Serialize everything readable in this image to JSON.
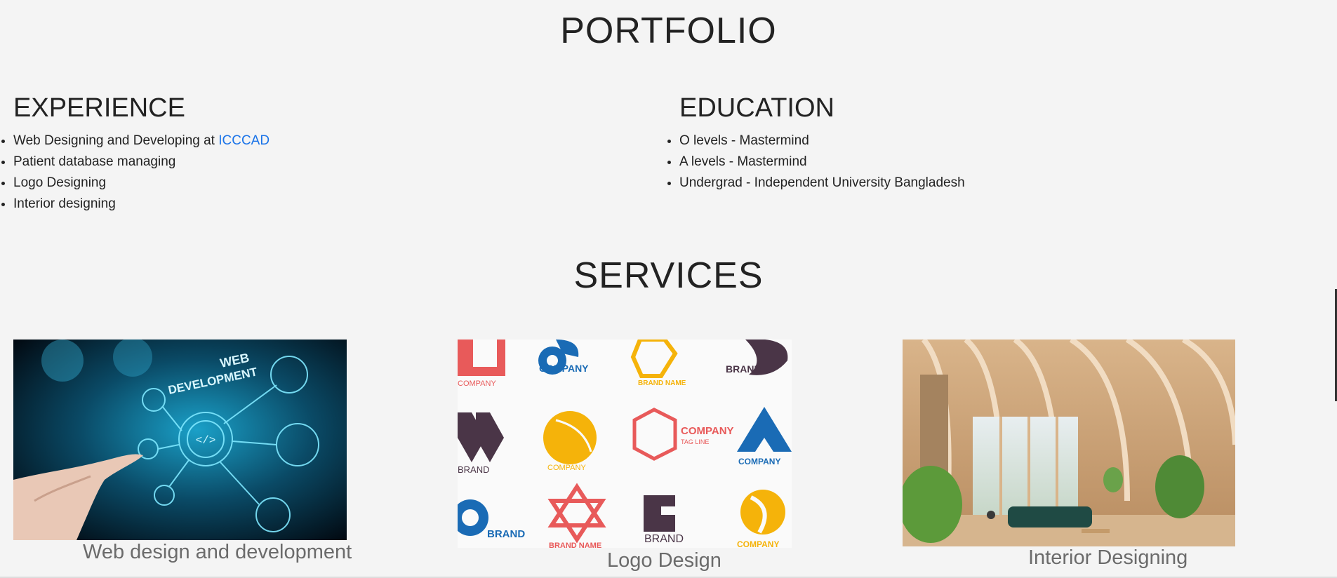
{
  "portfolio": {
    "title": "PORTFOLIO"
  },
  "experience": {
    "heading": "EXPERIENCE",
    "items": [
      {
        "text": "Web Designing and Developing at ",
        "link": "ICCCAD"
      },
      {
        "text": "Patient database managing"
      },
      {
        "text": "Logo Designing"
      },
      {
        "text": "Interior designing"
      }
    ]
  },
  "education": {
    "heading": "EDUCATION",
    "items": [
      "O levels - Mastermind",
      "A levels - Mastermind",
      "Undergrad - Independent University Bangladesh"
    ]
  },
  "services": {
    "title": "SERVICES",
    "cards": [
      {
        "caption": "Web design and development",
        "image_text": [
          "WEB",
          "DEVELOPMENT"
        ]
      },
      {
        "caption": "Logo Design",
        "logo_texts": [
          "COMPANY",
          "COMPANY",
          "BRAND NAME",
          "BRAND",
          "BRAND",
          "COMPANY",
          "COMPANY",
          "TAG LINE",
          "COMPANY",
          "BRAND",
          "BRAND NAME",
          "BRAND",
          "COMPANY"
        ]
      },
      {
        "caption": "Interior Designing"
      }
    ]
  },
  "colors": {
    "background": "#f4f4f4",
    "link": "#1a73e8",
    "caption": "#6b6b6b"
  }
}
